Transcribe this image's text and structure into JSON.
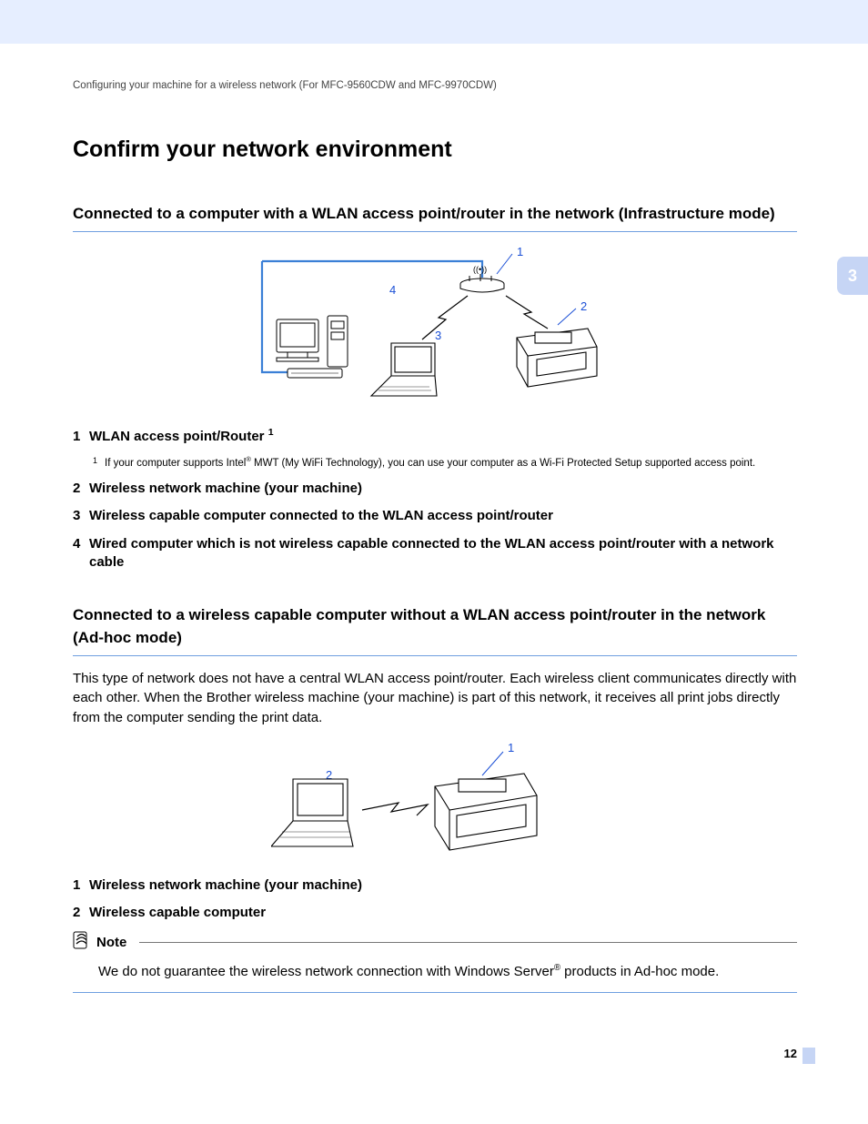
{
  "breadcrumb": "Configuring your machine for a wireless network (For MFC-9560CDW and MFC-9970CDW)",
  "chapter_tab": "3",
  "page_number": "12",
  "main_title": "Confirm your network environment",
  "section1": {
    "title": "Connected to a computer with a WLAN access point/router in the network (Infrastructure mode)",
    "diagram_labels": {
      "l1": "1",
      "l2": "2",
      "l3": "3",
      "l4": "4"
    },
    "legend": [
      {
        "num": "1",
        "text_pre": "WLAN access point/Router ",
        "sup": "1"
      },
      {
        "num": "2",
        "text": "Wireless network machine (your machine)"
      },
      {
        "num": "3",
        "text": "Wireless capable computer connected to the WLAN access point/router"
      },
      {
        "num": "4",
        "text": "Wired computer which is not wireless capable connected to the WLAN access point/router with a network cable"
      }
    ],
    "footnote": {
      "mark": "1",
      "pre": "If your computer supports Intel",
      "post": " MWT (My WiFi Technology), you can use your computer as a Wi-Fi Protected Setup supported access point."
    }
  },
  "section2": {
    "title": "Connected to a wireless capable computer without a WLAN access point/router in the network (Ad-hoc mode)",
    "body": "This type of network does not have a central WLAN access point/router. Each wireless client communicates directly with each other. When the Brother wireless machine (your machine) is part of this network, it receives all print jobs directly from the computer sending the print data.",
    "diagram_labels": {
      "l1": "1",
      "l2": "2"
    },
    "legend": [
      {
        "num": "1",
        "text": "Wireless network machine (your machine)"
      },
      {
        "num": "2",
        "text": "Wireless capable computer"
      }
    ]
  },
  "note": {
    "label": "Note",
    "body_pre": "We do not guarantee the wireless network connection with Windows Server",
    "body_post": " products in Ad-hoc mode."
  }
}
